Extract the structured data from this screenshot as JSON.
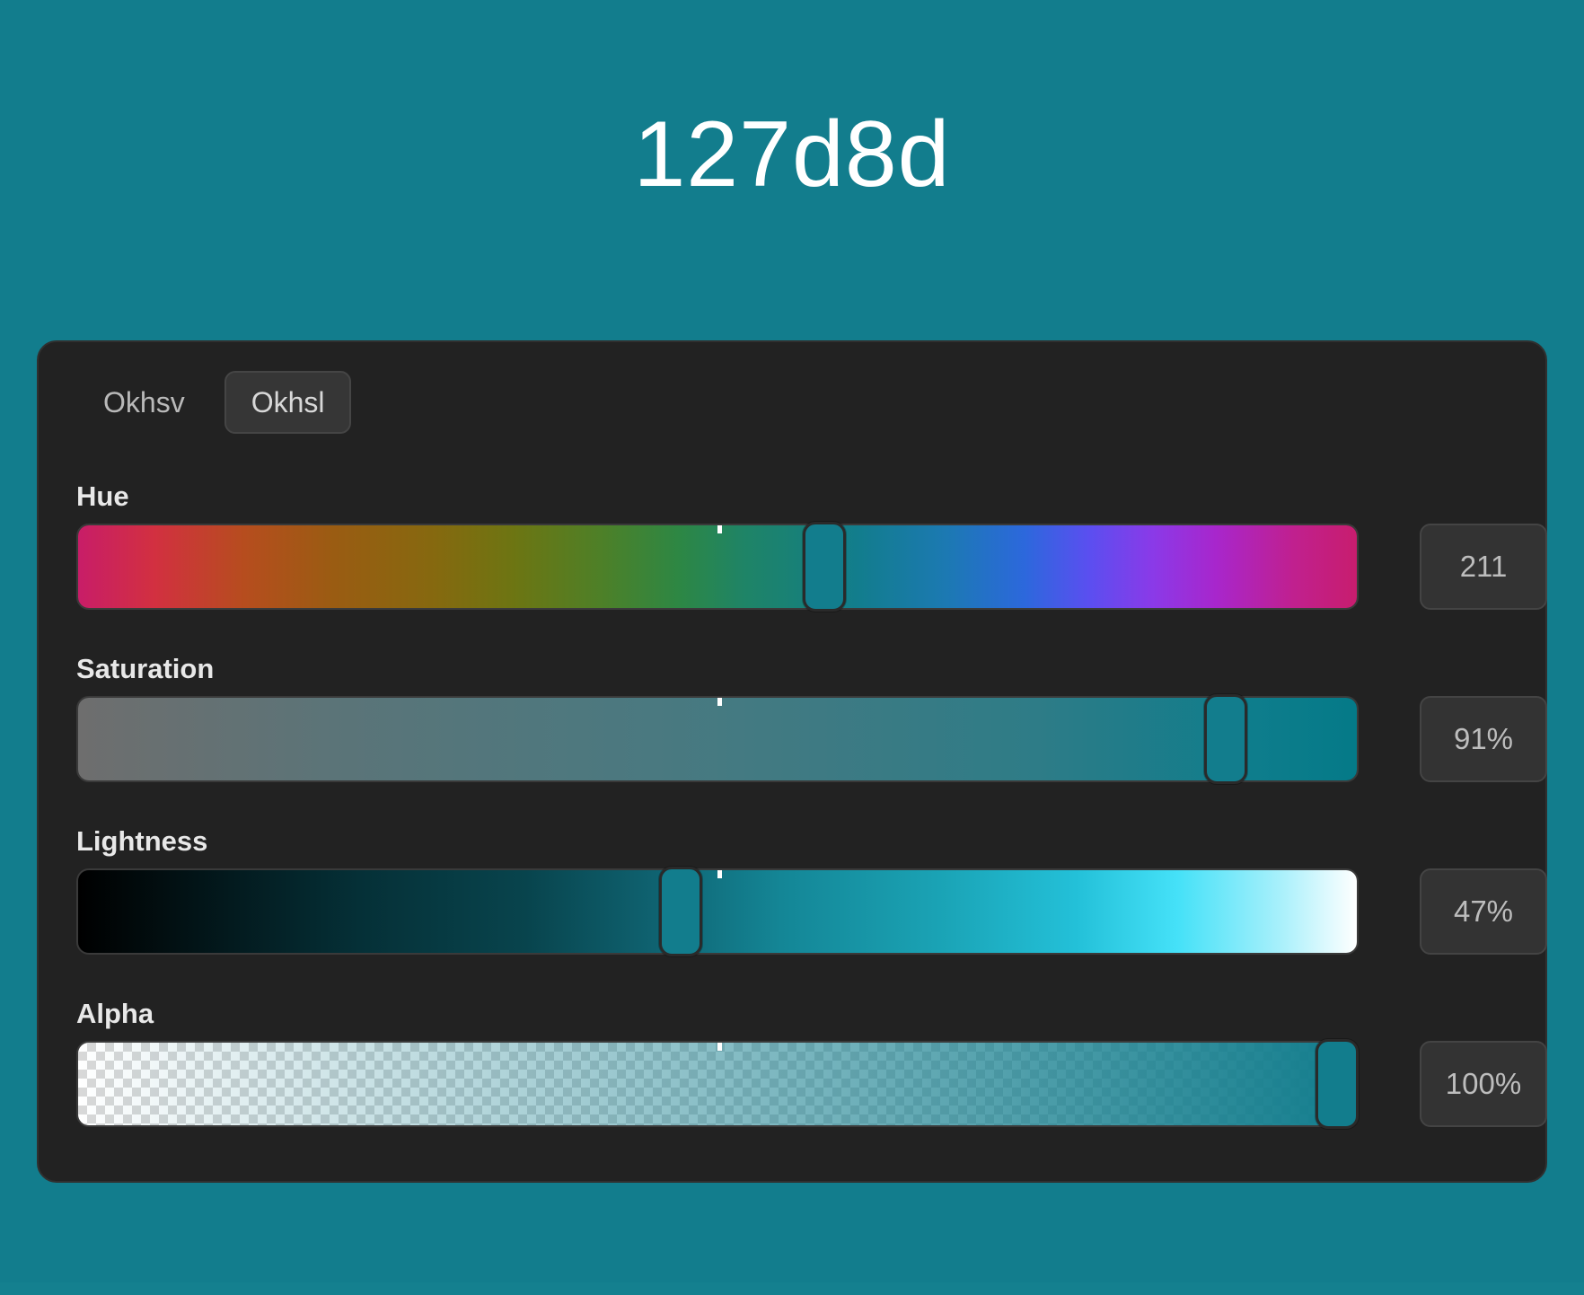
{
  "color": {
    "hex": "127d8d",
    "value": "#127d8d"
  },
  "tabs": [
    {
      "label": "Okhsv",
      "active": false
    },
    {
      "label": "Okhsl",
      "active": true
    }
  ],
  "sliders": {
    "hue": {
      "label": "Hue",
      "value_text": "211",
      "value": 211,
      "max": 360
    },
    "saturation": {
      "label": "Saturation",
      "value_text": "91%",
      "value": 91,
      "max": 100
    },
    "lightness": {
      "label": "Lightness",
      "value_text": "47%",
      "value": 47,
      "max": 100
    },
    "alpha": {
      "label": "Alpha",
      "value_text": "100%",
      "value": 100,
      "max": 100
    }
  },
  "colors": {
    "background": "#127d8d",
    "panel": "#222222",
    "thumb_fill": "#127d8d",
    "value_box": "#333333"
  }
}
